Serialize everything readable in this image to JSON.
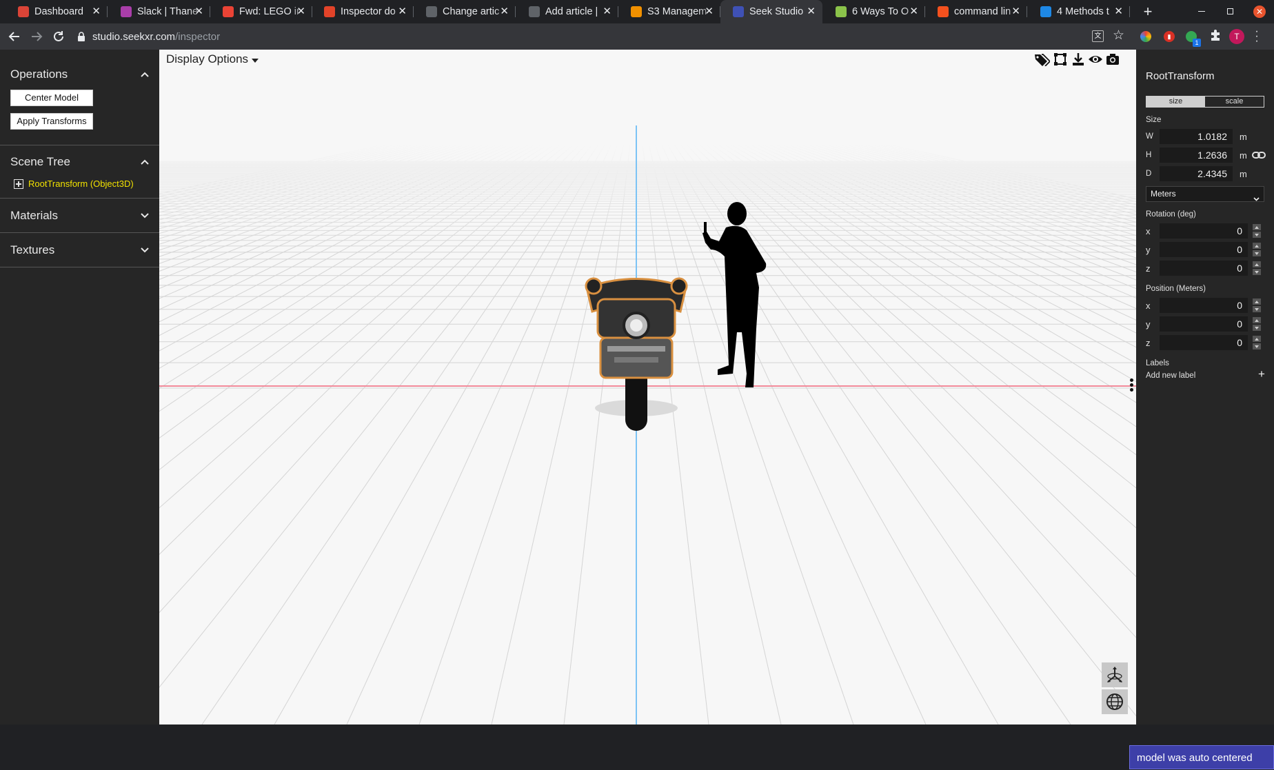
{
  "browser": {
    "tabs": [
      {
        "title": "Dashboard",
        "color": "#db4437"
      },
      {
        "title": "Slack | Thane",
        "color": "#a93ea9"
      },
      {
        "title": "Fwd: LEGO ir",
        "color": "#ea4335"
      },
      {
        "title": "Inspector do",
        "color": "#e24329"
      },
      {
        "title": "Change artic",
        "color": "#5f6368"
      },
      {
        "title": "Add article |",
        "color": "#5f6368"
      },
      {
        "title": "S3 Managem",
        "color": "#f29100"
      },
      {
        "title": "Seek Studio",
        "color": "#3f51b5"
      },
      {
        "title": "6 Ways To O",
        "color": "#8bc34a"
      },
      {
        "title": "command lin",
        "color": "#f4511e"
      },
      {
        "title": "4 Methods t",
        "color": "#1e88e5"
      }
    ],
    "active_tab": 7,
    "new_tab": "+",
    "url_host": "studio.seekxr.com",
    "url_path": "/inspector",
    "profile_initial": "T",
    "ext_badge": "1"
  },
  "sidebar": {
    "operations": {
      "title": "Operations",
      "center_model": "Center Model",
      "apply_transforms": "Apply Transforms"
    },
    "scene_tree": {
      "title": "Scene Tree",
      "root_node": "RootTransform (Object3D)"
    },
    "materials": {
      "title": "Materials"
    },
    "textures": {
      "title": "Textures"
    }
  },
  "viewport": {
    "display_options": "Display Options"
  },
  "inspector": {
    "title": "RootTransform",
    "toggle": {
      "size": "size",
      "scale": "scale",
      "active": "size"
    },
    "size": {
      "label": "Size",
      "w_label": "W",
      "w": "1.0182",
      "h_label": "H",
      "h": "1.2636",
      "d_label": "D",
      "d": "2.4345",
      "unit": "m"
    },
    "units_select": "Meters",
    "rotation": {
      "label": "Rotation (deg)",
      "x_label": "x",
      "x": "0",
      "y_label": "y",
      "y": "0",
      "z_label": "z",
      "z": "0"
    },
    "position": {
      "label": "Position (Meters)",
      "x_label": "x",
      "x": "0",
      "y_label": "y",
      "y": "0",
      "z_label": "z",
      "z": "0"
    },
    "labels": {
      "label": "Labels",
      "add": "Add new label",
      "add_icon": "+"
    }
  },
  "toast": "model was auto centered"
}
